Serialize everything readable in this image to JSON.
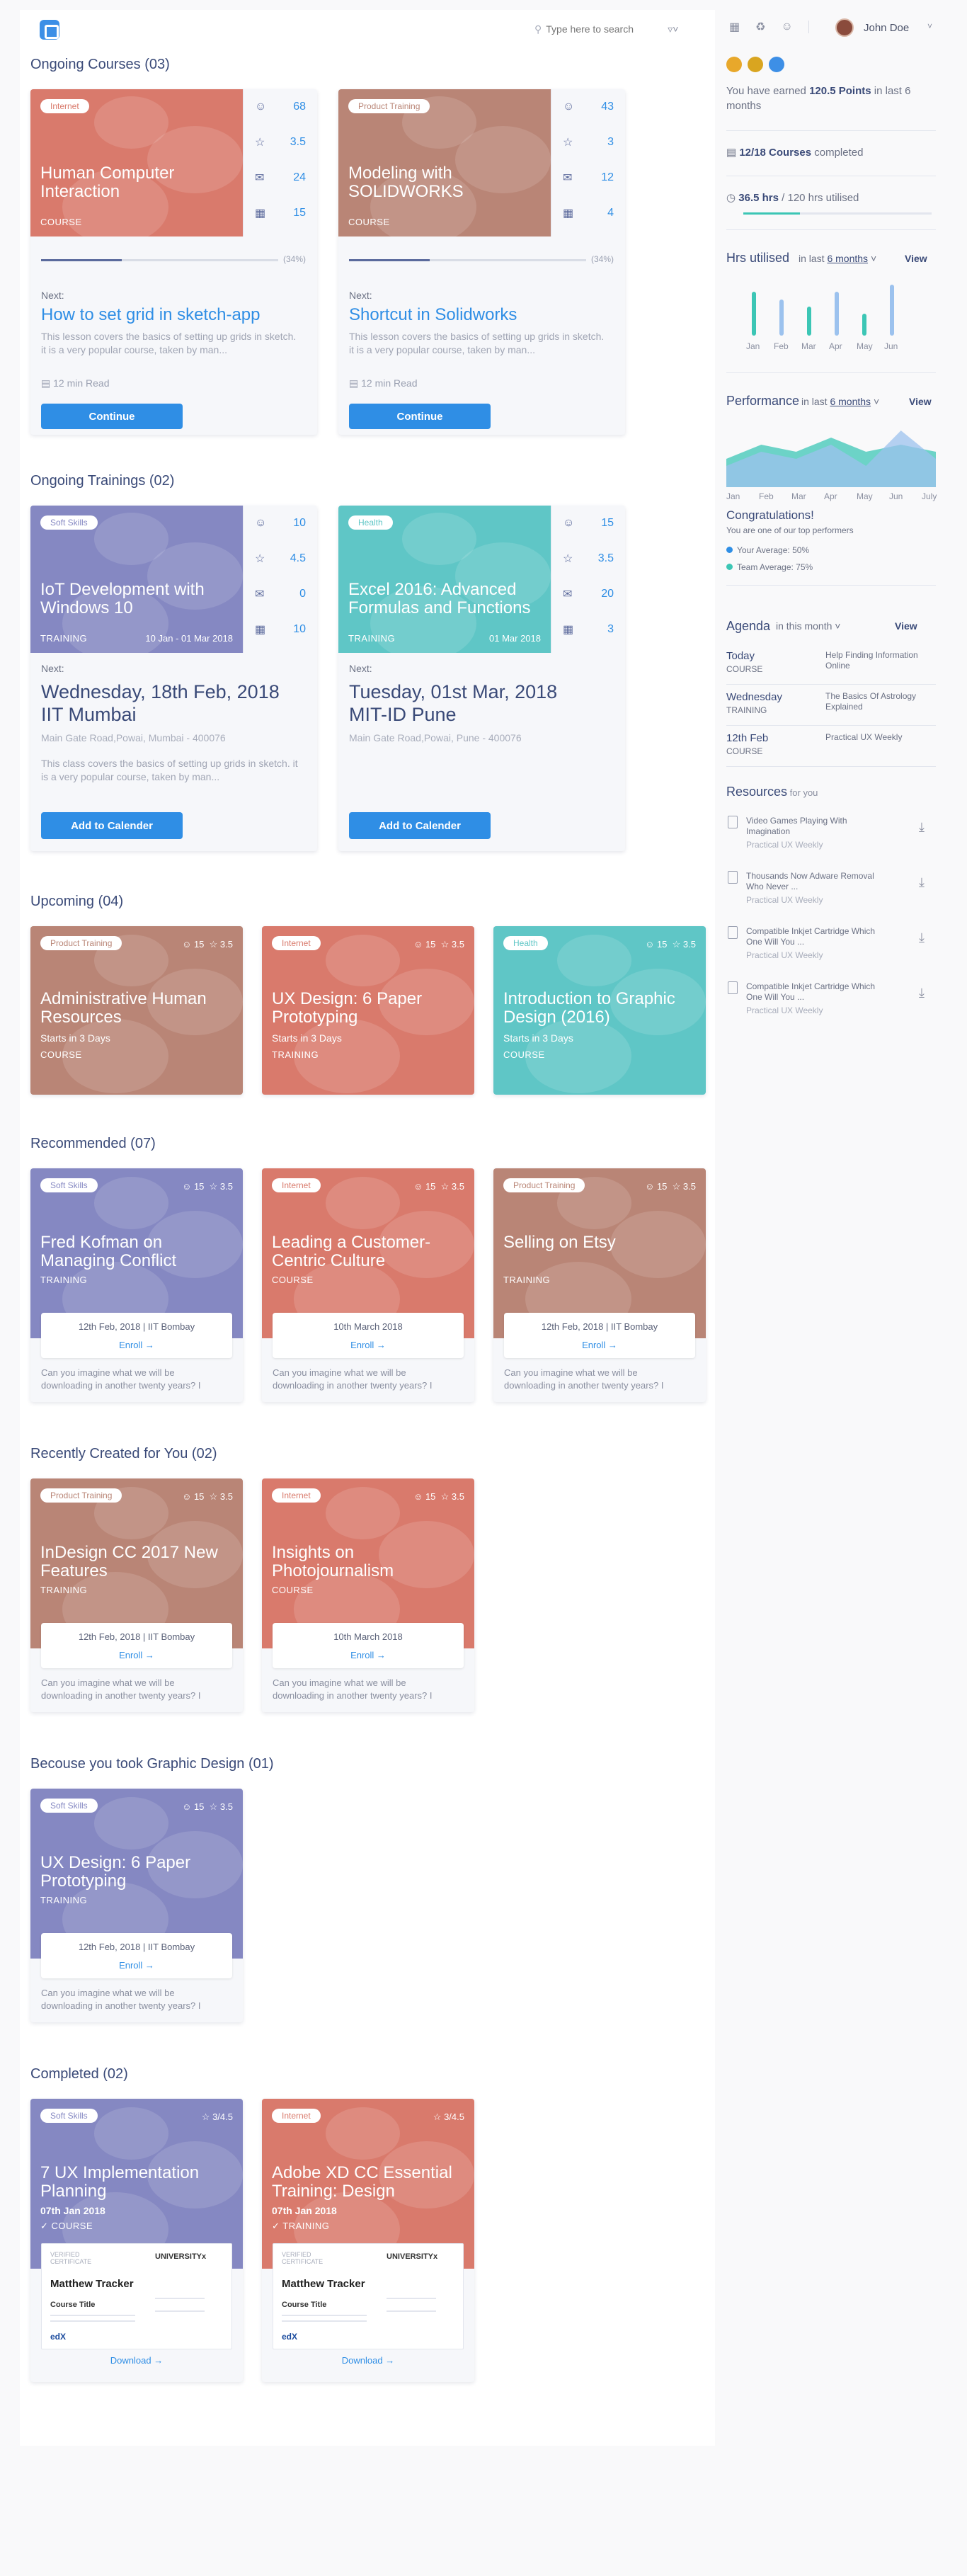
{
  "topbar": {
    "search_placeholder": "Type here to search",
    "user_name": "John Doe"
  },
  "colors": {
    "accent": "#2f8ee5",
    "internet": "#d97a6c",
    "product": "#b98576",
    "soft": "#8588c2",
    "health": "#5fc6c6"
  },
  "sections": {
    "ongoing_courses": "Ongoing Courses (03)",
    "ongoing_trainings": "Ongoing Trainings (02)",
    "upcoming": "Upcoming  (04)",
    "recommended": "Recommended (07)",
    "recent": "Recently Created for You (02)",
    "because": "Becouse you took Graphic Design (01)",
    "completed": "Completed (02)"
  },
  "ongoing_courses": [
    {
      "tag": "Internet",
      "title": "Human Computer Interaction",
      "type": "COURSE",
      "stats": [
        "68",
        "3.5",
        "24",
        "15"
      ],
      "pct": "(34%)",
      "progress": 0.34,
      "next_label": "Next:",
      "next_title": "How to set grid in sketch-app",
      "desc": "This lesson covers the basics of setting up grids in sketch. it is a very popular course, taken by man...",
      "read": "12 min Read",
      "button": "Continue"
    },
    {
      "tag": "Product Training",
      "title": "Modeling with SOLIDWORKS",
      "type": "COURSE",
      "stats": [
        "43",
        "3",
        "12",
        "4"
      ],
      "pct": "(34%)",
      "progress": 0.34,
      "next_label": "Next:",
      "next_title": "Shortcut in Solidworks",
      "desc": "This lesson covers the basics of setting up grids in sketch. it is a very popular course, taken by man...",
      "read": "12 min Read",
      "button": "Continue"
    }
  ],
  "ongoing_trainings": [
    {
      "tag": "Soft Skills",
      "title": "IoT Development with Windows 10",
      "type": "TRAINING",
      "dates": "10 Jan - 01 Mar 2018",
      "stats": [
        "10",
        "4.5",
        "0",
        "10"
      ],
      "next_label": "Next:",
      "date_line": "Wednesday,  18th Feb, 2018",
      "place": "IIT Mumbai",
      "address": "Main Gate Road,Powai, Mumbai - 400076",
      "desc": "This class covers the basics of setting up grids in sketch. it is a very popular course, taken by man...",
      "button": "Add to Calender"
    },
    {
      "tag": "Health",
      "title": "Excel 2016: Advanced Formulas and Functions",
      "type": "TRAINING",
      "dates": "01 Mar 2018",
      "stats": [
        "15",
        "3.5",
        "20",
        "3"
      ],
      "next_label": "Next:",
      "date_line": "Tuesday,  01st Mar, 2018",
      "place": "MIT-ID Pune",
      "address": "Main Gate Road,Powai, Pune - 400076",
      "desc": "",
      "button": "Add to Calender"
    }
  ],
  "upcoming": [
    {
      "tag": "Product Training",
      "title": "Administrative Human Resources",
      "sub": "Starts in 3 Days",
      "type": "COURSE",
      "users": "15",
      "rating": "3.5"
    },
    {
      "tag": "Internet",
      "title": "UX Design: 6 Paper Prototyping",
      "sub": "Starts in 3 Days",
      "type": "TRAINING",
      "users": "15",
      "rating": "3.5"
    },
    {
      "tag": "Health",
      "title": "Introduction to Graphic Design (2016)",
      "sub": "Starts in 3 Days",
      "type": "COURSE",
      "users": "15",
      "rating": "3.5"
    }
  ],
  "recommended": [
    {
      "tag": "Soft Skills",
      "title": "Fred Kofman on Managing Conflict",
      "type": "TRAINING",
      "users": "15",
      "rating": "3.5",
      "date": "12th Feb, 2018 | IIT Bombay",
      "link": "Enroll →",
      "foot": "Can you imagine what we will be downloading in another twenty years? I"
    },
    {
      "tag": "Internet",
      "title": "Leading a Customer-Centric Culture",
      "type": "COURSE",
      "users": "15",
      "rating": "3.5",
      "date": "10th March 2018",
      "link": "Enroll →",
      "foot": "Can you imagine what we will be downloading in another twenty years? I"
    },
    {
      "tag": "Product Training",
      "title": "Selling on Etsy",
      "type": "TRAINING",
      "users": "15",
      "rating": "3.5",
      "date": "12th Feb, 2018 | IIT Bombay",
      "link": "Enroll →",
      "foot": "Can you imagine what we will be downloading in another twenty years? I"
    }
  ],
  "recent": [
    {
      "tag": "Product Training",
      "title": "InDesign CC 2017 New Features",
      "type": "TRAINING",
      "users": "15",
      "rating": "3.5",
      "date": "12th Feb, 2018 | IIT Bombay",
      "link": "Enroll →",
      "foot": "Can you imagine what we will be downloading in another twenty years? I"
    },
    {
      "tag": "Internet",
      "title": "Insights on Photojournalism",
      "type": "COURSE",
      "users": "15",
      "rating": "3.5",
      "date": "10th March 2018",
      "link": "Enroll →",
      "foot": "Can you imagine what we will be downloading in another twenty years? I"
    }
  ],
  "because": [
    {
      "tag": "Soft Skills",
      "title": "UX Design: 6 Paper Prototyping",
      "type": "TRAINING",
      "users": "15",
      "rating": "3.5",
      "date": "12th Feb, 2018 | IIT Bombay",
      "link": "Enroll →",
      "foot": "Can you imagine what we will be downloading in another twenty years? I"
    }
  ],
  "completed": [
    {
      "tag": "Soft Skills",
      "title": "7 UX Implementation Planning",
      "date": "07th Jan 2018",
      "type": "COURSE",
      "score": "3/4.5",
      "cert_name": "Matthew Tracker",
      "cert_course": "Course Title",
      "cert_org": "UNIVERSITYx",
      "cert_verified": "VERIFIED CERTIFICATE",
      "cert_logo": "edX",
      "link": "Download →"
    },
    {
      "tag": "Internet",
      "title": "Adobe XD CC Essential Training: Design",
      "date": "07th Jan 2018",
      "type": "TRAINING",
      "score": "3/4.5",
      "cert_name": "Matthew Tracker",
      "cert_course": "Course Title",
      "cert_org": "UNIVERSITYx",
      "cert_verified": "VERIFIED CERTIFICATE",
      "cert_logo": "edX",
      "link": "Download →"
    }
  ],
  "right": {
    "points_pre": "You have earned ",
    "points_val": "120.5 Points",
    "points_post": " in last 6 months",
    "courses_val": "12/18 Courses",
    "courses_post": " completed",
    "hrs_val": "36.5 hrs",
    "hrs_post": " / 120 hrs utilised",
    "hrs_progress": 0.3,
    "hrs_title": "Hrs utilised",
    "in_last": "in last",
    "period": "6 months",
    "view": "View",
    "perf_title": "Performance",
    "months_short": [
      "Jan",
      "Feb",
      "Mar",
      "Apr",
      "May",
      "Jun"
    ],
    "months_perf": [
      "Jan",
      "Feb",
      "Mar",
      "Apr",
      "May",
      "Jun",
      "July"
    ],
    "congrats": "Congratulations!",
    "congrats_sub": "You are one of our top performers",
    "your_avg": "Your Average: 50%",
    "team_avg": "Team Average: 75%",
    "agenda_title": "Agenda",
    "agenda_sub": "in this month",
    "agenda": [
      {
        "day": "Today",
        "type": "COURSE",
        "title": "Help Finding Information Online"
      },
      {
        "day": "Wednesday",
        "type": "TRAINING",
        "title": "The Basics Of Astrology Explained"
      },
      {
        "day": "12th Feb",
        "type": "COURSE",
        "title": "Practical UX Weekly"
      }
    ],
    "resources_title": "Resources",
    "resources_sub": "for you",
    "resources": [
      {
        "title": "Video Games Playing With Imagination",
        "sub": "Practical UX Weekly"
      },
      {
        "title": "Thousands Now Adware Removal Who Never ...",
        "sub": "Practical UX Weekly"
      },
      {
        "title": "Compatible Inkjet Cartridge Which One Will You ...",
        "sub": "Practical UX Weekly"
      },
      {
        "title": "Compatible Inkjet Cartridge Which One Will You ...",
        "sub": "Practical UX Weekly"
      }
    ]
  },
  "chart_data": [
    {
      "type": "bar",
      "title": "Hrs utilised",
      "categories": [
        "Jan",
        "Feb",
        "Mar",
        "Apr",
        "May",
        "Jun"
      ],
      "series": [
        {
          "values": [
            6,
            5,
            4,
            6,
            3,
            7
          ]
        }
      ]
    },
    {
      "type": "area",
      "title": "Performance",
      "categories": [
        "Jan",
        "Feb",
        "Mar",
        "Apr",
        "May",
        "Jun",
        "July"
      ],
      "series": [
        {
          "name": "Your Average: 50%",
          "values": [
            3,
            5,
            4,
            6,
            3,
            8,
            4
          ]
        },
        {
          "name": "Team Average: 75%",
          "values": [
            4,
            6,
            5,
            7,
            5,
            6,
            5
          ]
        }
      ]
    }
  ]
}
